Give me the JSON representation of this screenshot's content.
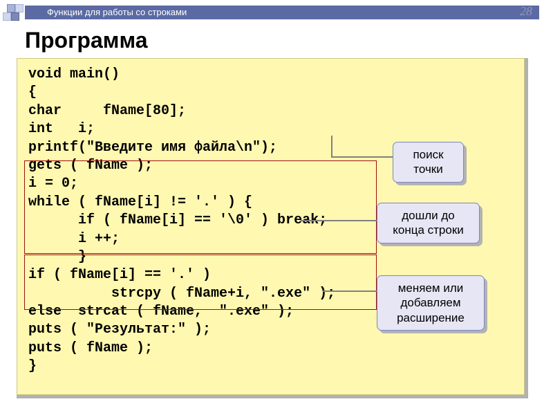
{
  "header": {
    "breadcrumb": "Функции для работы со строками",
    "page_number": "28"
  },
  "title": "Программа",
  "code": {
    "l1": "void main()",
    "l2": "{",
    "l3": "char     fName[80];",
    "l4": "int   i;",
    "l5": "printf(\"Введите имя файла\\n\");",
    "l6": "gets ( fName );",
    "l7": "i = 0;",
    "l8": "while ( fName[i] != '.' ) {",
    "l9": "      if ( fName[i] == '\\0' ) break;",
    "l10": "      i ++;",
    "l11": "      }",
    "l12": "if ( fName[i] == '.' )",
    "l13": "          strcpy ( fName+i, \".exe\" );",
    "l14": "else  strcat ( fName,  \".exe\" );",
    "l15": "puts ( \"Результат:\" );",
    "l16": "puts ( fName );",
    "l17": "}"
  },
  "callouts": {
    "c1": "поиск точки",
    "c2": "дошли до конца строки",
    "c3": "меняем или добавляем расширение"
  }
}
